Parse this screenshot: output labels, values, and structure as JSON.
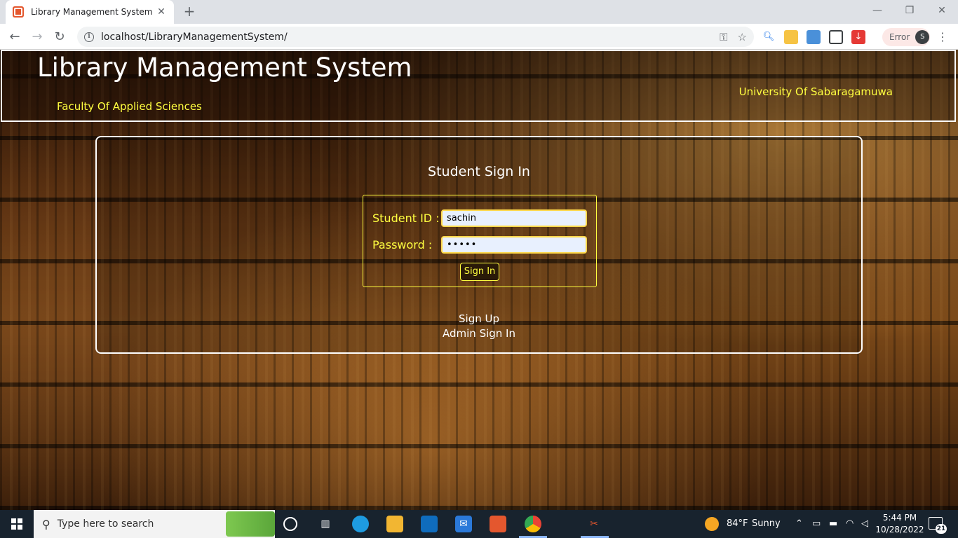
{
  "browser": {
    "tab_title": "Library Management System",
    "tab_close": "✕",
    "new_tab": "+",
    "window_controls": {
      "minimize": "—",
      "restore": "❐",
      "close": "✕"
    },
    "nav": {
      "back": "←",
      "forward": "→",
      "reload": "↻"
    },
    "url": "localhost/LibraryManagementSystem/",
    "omnibox_icons": {
      "key": "⚿",
      "star": "☆"
    },
    "error_label": "Error",
    "profile_initial": "S",
    "menu": "⋮"
  },
  "header": {
    "title": "Library Management System",
    "faculty": "Faculty Of Applied Sciences",
    "university": "University Of Sabaragamuwa"
  },
  "login": {
    "heading": "Student Sign In",
    "student_id_label": "Student ID :",
    "student_id_value": "sachin",
    "password_label": "Password :",
    "password_value": "•••••",
    "sign_in_button": "Sign In",
    "sign_up_link": "Sign Up",
    "admin_link": "Admin Sign In"
  },
  "taskbar": {
    "search_placeholder": "Type here to search",
    "weather_temp": "84°F",
    "weather_text": "Sunny",
    "time": "5:44 PM",
    "date": "10/28/2022",
    "notifications": "21"
  },
  "colors": {
    "accent_yellow": "#ffff40",
    "tab_strip": "#dee1e6",
    "taskbar": "#18232e"
  }
}
